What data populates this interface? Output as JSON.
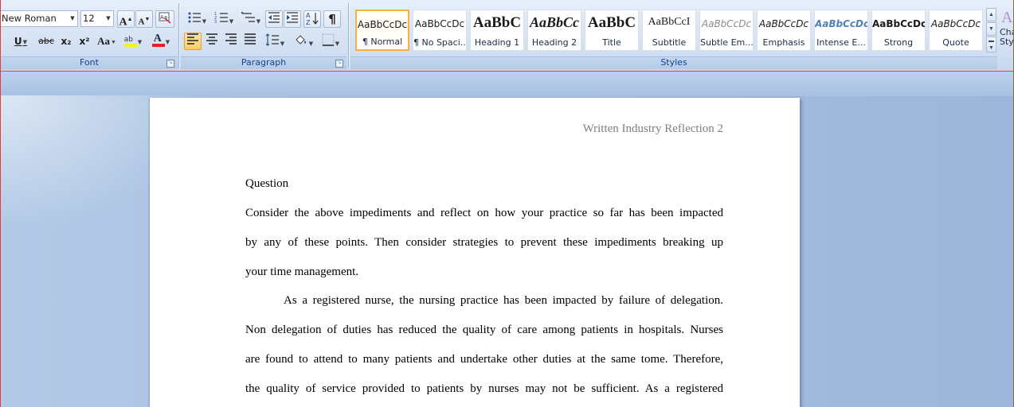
{
  "ribbon": {
    "font_group": {
      "label": "Font",
      "font_name": "New Roman",
      "font_size": "12",
      "grow_font": "A",
      "shrink_font": "A",
      "underline": "U",
      "strikethrough": "abc",
      "subscript": "x₂",
      "superscript": "x²",
      "change_case": "Aa",
      "highlight": "ab",
      "font_color": "A",
      "font_color_hex": "#e2231a",
      "highlight_hex": "#f7f01e"
    },
    "paragraph_group": {
      "label": "Paragraph",
      "sort": "A↓Z",
      "show_marks": "¶"
    },
    "styles_group": {
      "label": "Styles",
      "change_styles": [
        "Cha",
        "Sty"
      ],
      "items": [
        {
          "sample": "AaBbCcDc",
          "name": "¶ Normal"
        },
        {
          "sample": "AaBbCcDc",
          "name": "¶ No Spaci..."
        },
        {
          "sample": "AaBbC",
          "name": "Heading 1"
        },
        {
          "sample": "AaBbCc",
          "name": "Heading 2"
        },
        {
          "sample": "AaBbC",
          "name": "Title"
        },
        {
          "sample": "AaBbCcI",
          "name": "Subtitle"
        },
        {
          "sample": "AaBbCcDc",
          "name": "Subtle Em..."
        },
        {
          "sample": "AaBbCcDc",
          "name": "Emphasis"
        },
        {
          "sample": "AaBbCcDc",
          "name": "Intense E..."
        },
        {
          "sample": "AaBbCcDc",
          "name": "Strong"
        },
        {
          "sample": "AaBbCcDc",
          "name": "Quote"
        }
      ]
    }
  },
  "document": {
    "header": "Written Industry Reflection 2",
    "heading": "Question",
    "lines": [
      "Consider the above impediments and reflect on how your practice so far has been impacted",
      "by any of these points. Then consider strategies to prevent these impediments breaking up",
      "your time management.",
      "As a registered nurse, the nursing practice has been impacted by failure of delegation.",
      "Non delegation of duties has reduced the quality of care among patients in hospitals. Nurses",
      "are found to attend to many patients and undertake other duties at the same tome. Therefore,",
      "the quality of service provided to patients by nurses may not be sufficient. As a registered"
    ]
  },
  "colors": {
    "accent_orange": "#f3b342",
    "ribbon_label": "#15428b",
    "window_border": "#e23b3b"
  }
}
